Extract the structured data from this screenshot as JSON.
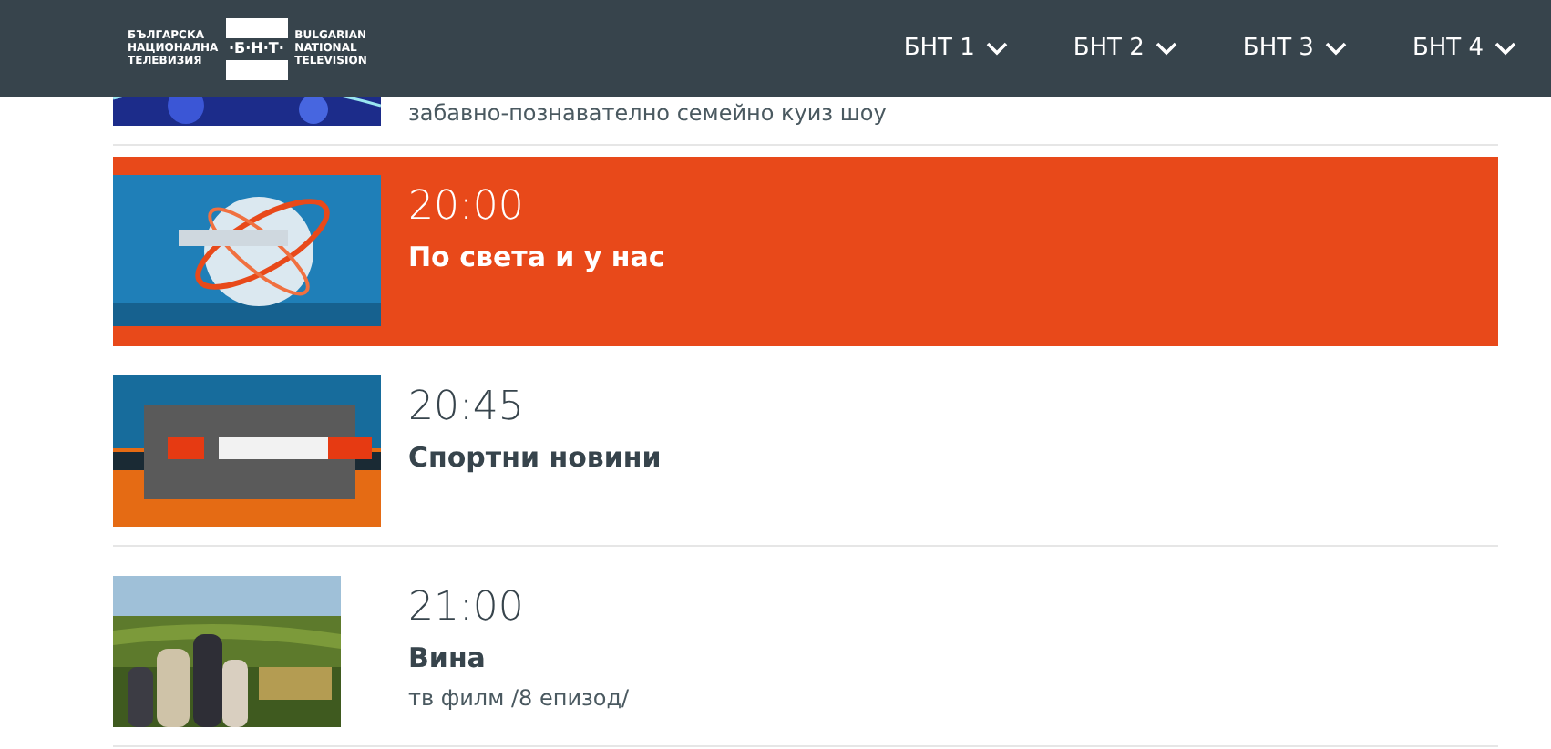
{
  "header": {
    "logo": {
      "left_lines": [
        "БЪЛГАРСКА",
        "НАЦИОНАЛНА",
        "ТЕЛЕВИЗИЯ"
      ],
      "mark": "·Б·Н·Т·",
      "right_lines": [
        "BULGARIAN",
        "NATIONAL",
        "TELEVISION"
      ]
    },
    "nav": [
      {
        "label": "БНТ 1"
      },
      {
        "label": "БНТ 2"
      },
      {
        "label": "БНТ 3"
      },
      {
        "label": "БНТ 4"
      }
    ]
  },
  "schedule": [
    {
      "selected": false,
      "description": "забавно-познавателно семейно куиз шоу"
    },
    {
      "selected": true,
      "time": "20:00",
      "title": "По света и у нас"
    },
    {
      "selected": false,
      "time": "20:45",
      "title": "Спортни новини"
    },
    {
      "selected": false,
      "time": "21:00",
      "title": "Вина",
      "description": "тв филм /8 епизод/"
    }
  ]
}
